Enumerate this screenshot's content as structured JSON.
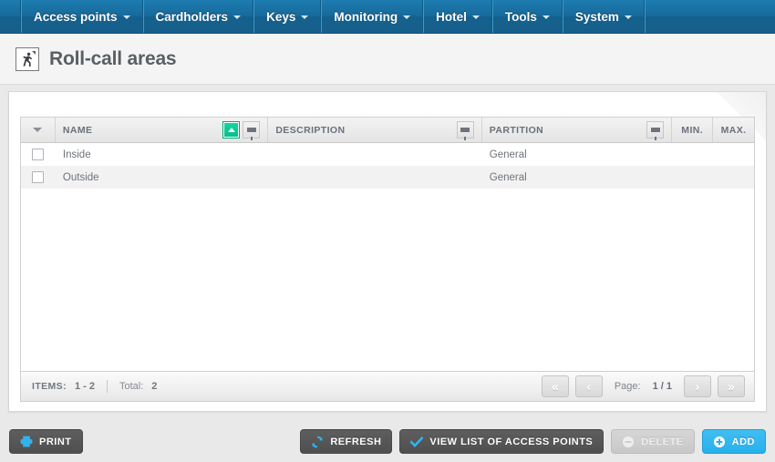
{
  "nav": {
    "items": [
      {
        "label": "Access points",
        "icon": "chevron-down-icon"
      },
      {
        "label": "Cardholders",
        "icon": "chevron-down-icon"
      },
      {
        "label": "Keys",
        "icon": "chevron-down-icon"
      },
      {
        "label": "Monitoring",
        "icon": "chevron-down-icon"
      },
      {
        "label": "Hotel",
        "icon": "chevron-down-icon"
      },
      {
        "label": "Tools",
        "icon": "chevron-down-icon"
      },
      {
        "label": "System",
        "icon": "chevron-down-icon"
      }
    ]
  },
  "page": {
    "title": "Roll-call areas",
    "icon": "running-person-exit-icon"
  },
  "grid": {
    "columns": [
      {
        "key": "check",
        "label": "",
        "icon": "chevron-down-icon"
      },
      {
        "key": "name",
        "label": "NAME",
        "sort": "asc",
        "filter": "filter-icon"
      },
      {
        "key": "description",
        "label": "DESCRIPTION",
        "filter": "filter-icon"
      },
      {
        "key": "partition",
        "label": "PARTITION",
        "filter": "filter-icon"
      },
      {
        "key": "min",
        "label": "MIN."
      },
      {
        "key": "max",
        "label": "MAX."
      }
    ],
    "rows": [
      {
        "selected": false,
        "name": "Inside",
        "description": "",
        "partition": "General",
        "min": "",
        "max": ""
      },
      {
        "selected": false,
        "name": "Outside",
        "description": "",
        "partition": "General",
        "min": "",
        "max": ""
      }
    ],
    "footer": {
      "items_label": "ITEMS:",
      "items_range": "1 - 2",
      "total_label": "Total:",
      "total_value": "2",
      "page_label": "Page:",
      "page_value": "1 / 1",
      "first_icon": "«",
      "prev_icon": "‹",
      "next_icon": "›",
      "last_icon": "»"
    }
  },
  "toolbar": {
    "print_label": "PRINT",
    "refresh_label": "REFRESH",
    "view_list_label": "VIEW LIST OF ACCESS POINTS",
    "delete_label": "DELETE",
    "add_label": "ADD"
  },
  "colors": {
    "nav_blue": "#17699a",
    "accent_blue": "#2fb4ee",
    "sort_green": "#02bd88",
    "toolbar_dark": "#555555",
    "disabled_grey": "#d0d0d0"
  }
}
